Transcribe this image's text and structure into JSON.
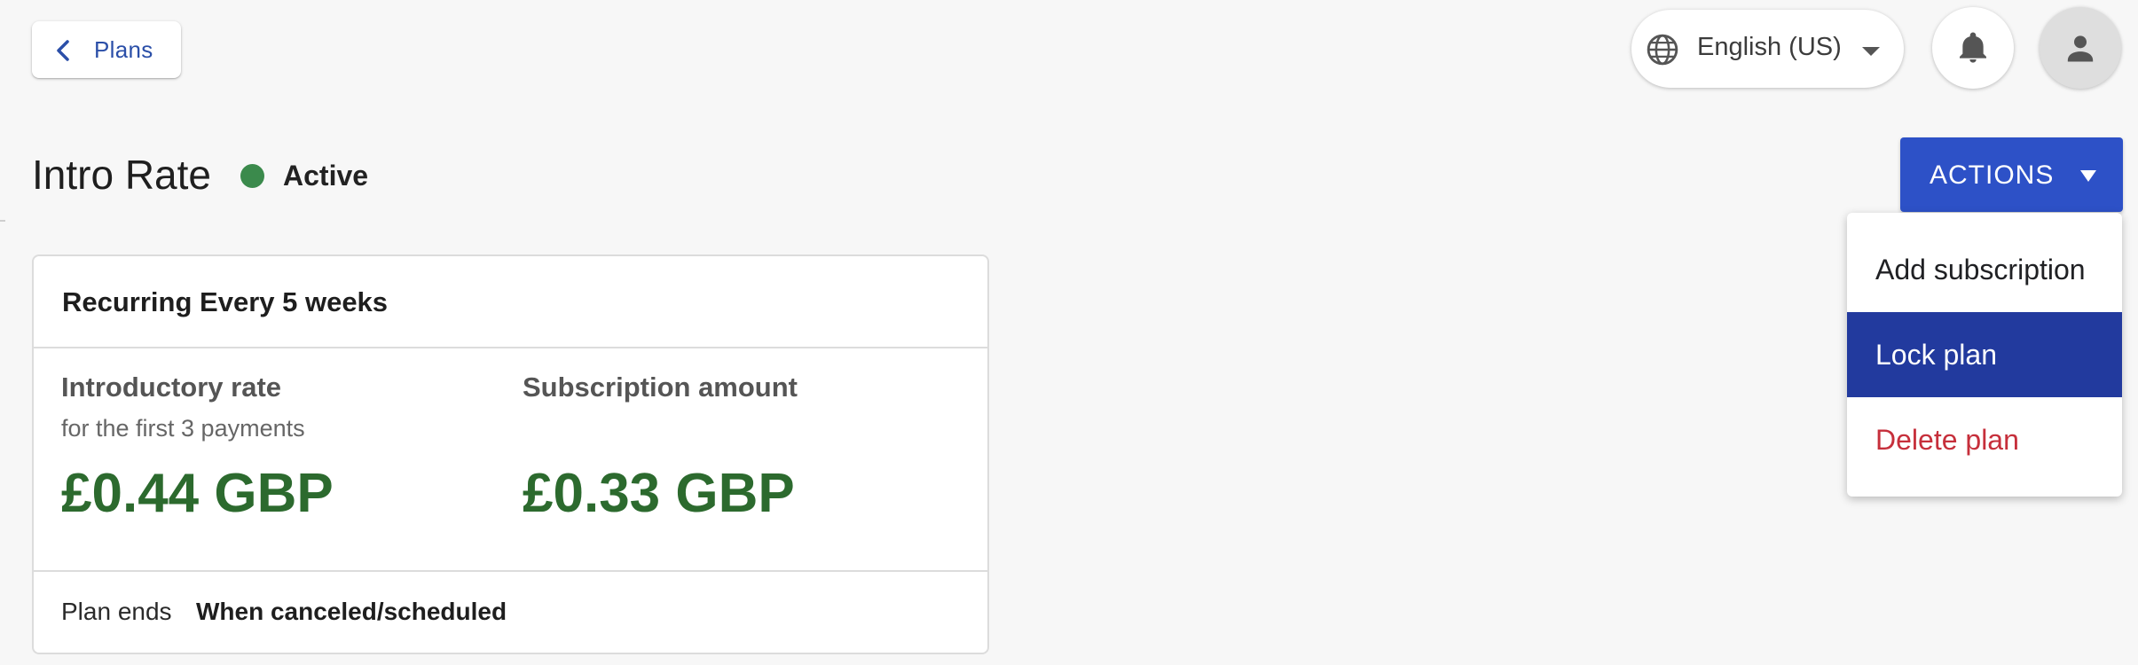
{
  "nav": {
    "back_label": "Plans"
  },
  "header": {
    "language_label": "English (US)",
    "icons": {
      "language": "globe-icon",
      "notifications": "bell-icon",
      "account": "person-icon"
    }
  },
  "plan": {
    "title": "Intro Rate",
    "status": "Active",
    "status_color": "#3b8a4c"
  },
  "actions": {
    "button_label": "ACTIONS",
    "accent": "#2d51c7",
    "menu": [
      {
        "label": "Add subscription"
      },
      {
        "label": "Lock plan",
        "highlighted": true
      },
      {
        "label": "Delete plan",
        "danger": true
      }
    ]
  },
  "card": {
    "header": "Recurring Every 5 weeks",
    "intro": {
      "heading": "Introductory rate",
      "sub": "for the first 3 payments",
      "amount": "£0.44 GBP"
    },
    "subscription": {
      "heading": "Subscription amount",
      "amount": "£0.33 GBP"
    },
    "ends_label": "Plan ends",
    "ends_value": "When canceled/scheduled"
  }
}
